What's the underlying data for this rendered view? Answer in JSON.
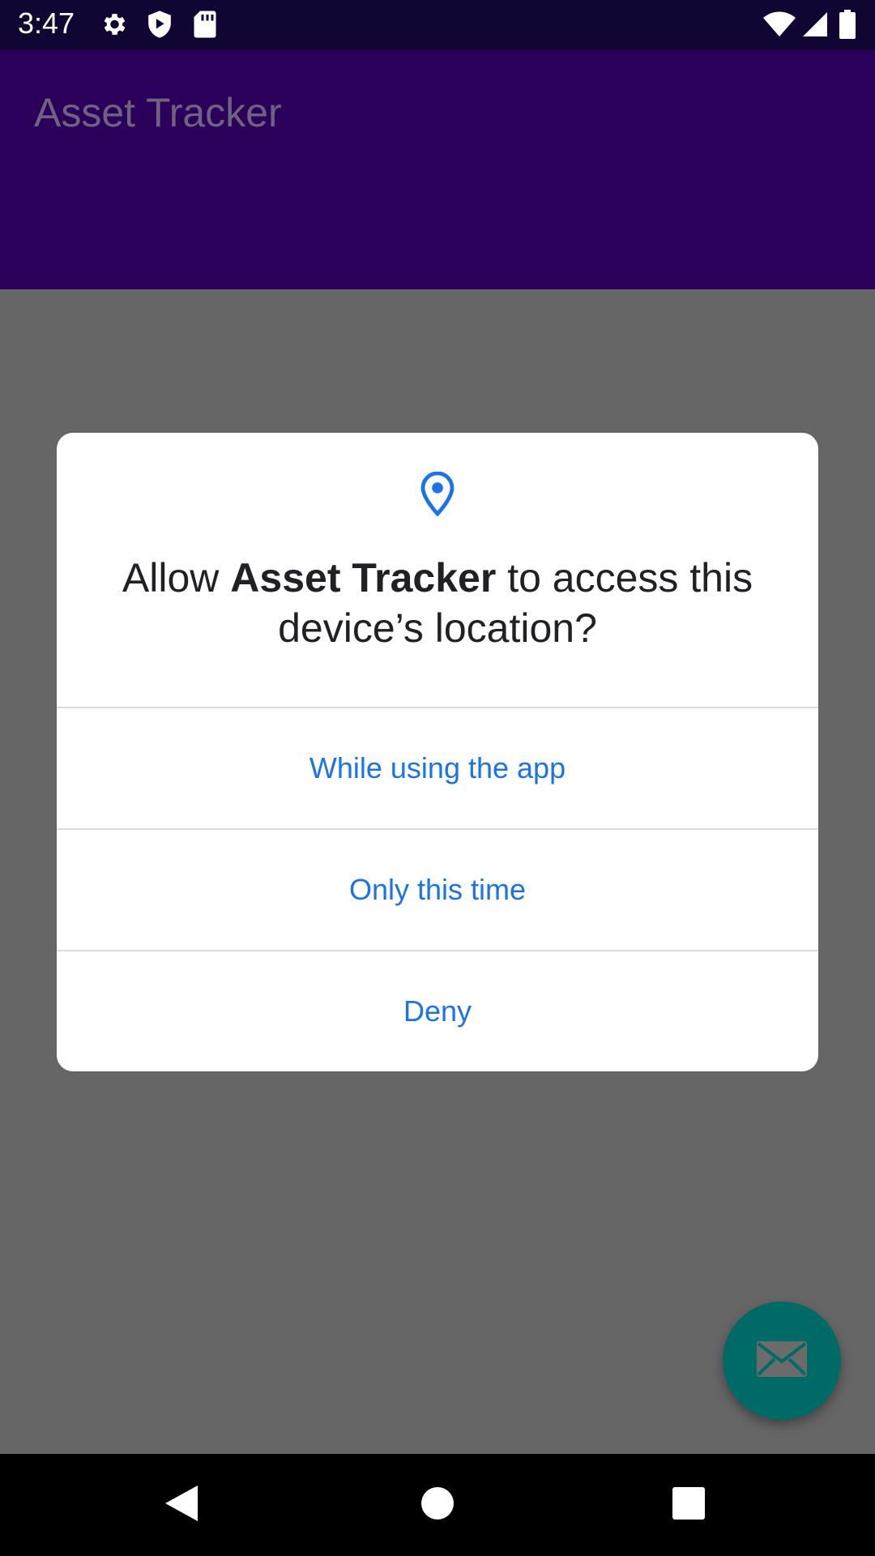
{
  "status_bar": {
    "time": "3:47",
    "icons_left": [
      "gear-icon",
      "shield-play-icon",
      "sd-card-icon"
    ],
    "icons_right": [
      "wifi-icon",
      "signal-icon",
      "battery-icon"
    ]
  },
  "app_bar": {
    "title": "Asset Tracker"
  },
  "dialog": {
    "icon": "location-pin-icon",
    "title_prefix": "Allow ",
    "title_app": "Asset Tracker",
    "title_suffix": " to access this device’s location?",
    "buttons": {
      "while_using": "While using the app",
      "only_this_time": "Only this time",
      "deny": "Deny"
    }
  },
  "fab": {
    "icon": "mail-icon"
  },
  "nav_bar": {
    "icons": [
      "back-icon",
      "home-icon",
      "recents-icon"
    ]
  },
  "colors": {
    "accent": "#1a73e8",
    "app_bar": "#2a005a",
    "fab": "#006b66"
  }
}
